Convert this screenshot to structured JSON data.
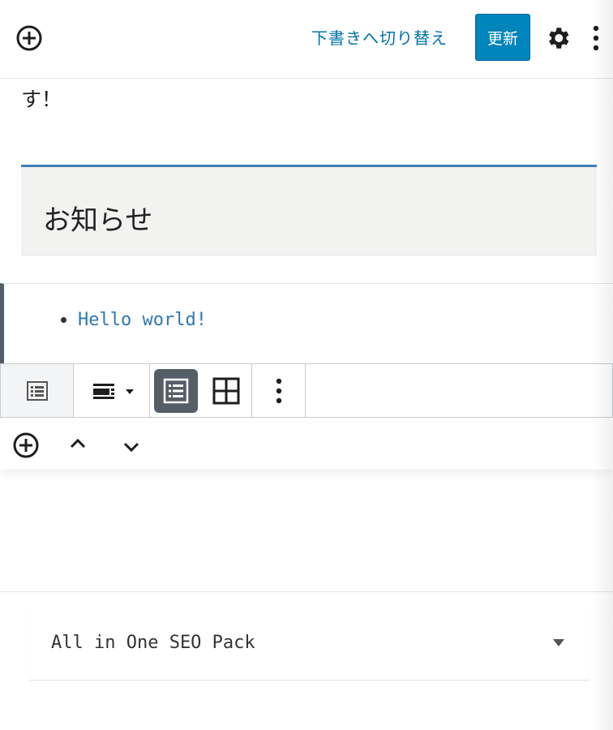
{
  "topbar": {
    "add_icon": "plus-circle-icon",
    "switch_to_draft_label": "下書きへ切り替え",
    "update_label": "更新",
    "settings_icon": "gear-icon",
    "more_icon": "vertical-ellipsis-icon"
  },
  "content": {
    "paragraph_tail": "す！",
    "heading": "お知らせ",
    "latest_posts": [
      "Hello world!"
    ]
  },
  "block_toolbar": {
    "block_type_icon": "latest-posts-icon",
    "align_icon": "align-wide-icon",
    "list_view_icon": "list-view-icon",
    "grid_view_icon": "grid-view-icon",
    "more_icon": "vertical-ellipsis-icon",
    "active_view": "list"
  },
  "block_mover": {
    "add_icon": "plus-circle-icon",
    "up_icon": "chevron-up-icon",
    "down_icon": "chevron-down-icon"
  },
  "meta_box": {
    "title": "All in One SEO Pack",
    "toggle_icon": "caret-down-icon"
  },
  "colors": {
    "accent": "#0073aa",
    "update_button": "#0085ba",
    "heading_border": "#3f7fb3",
    "heading_bg": "#f2f3f1",
    "active_view_bg": "#555d66"
  }
}
